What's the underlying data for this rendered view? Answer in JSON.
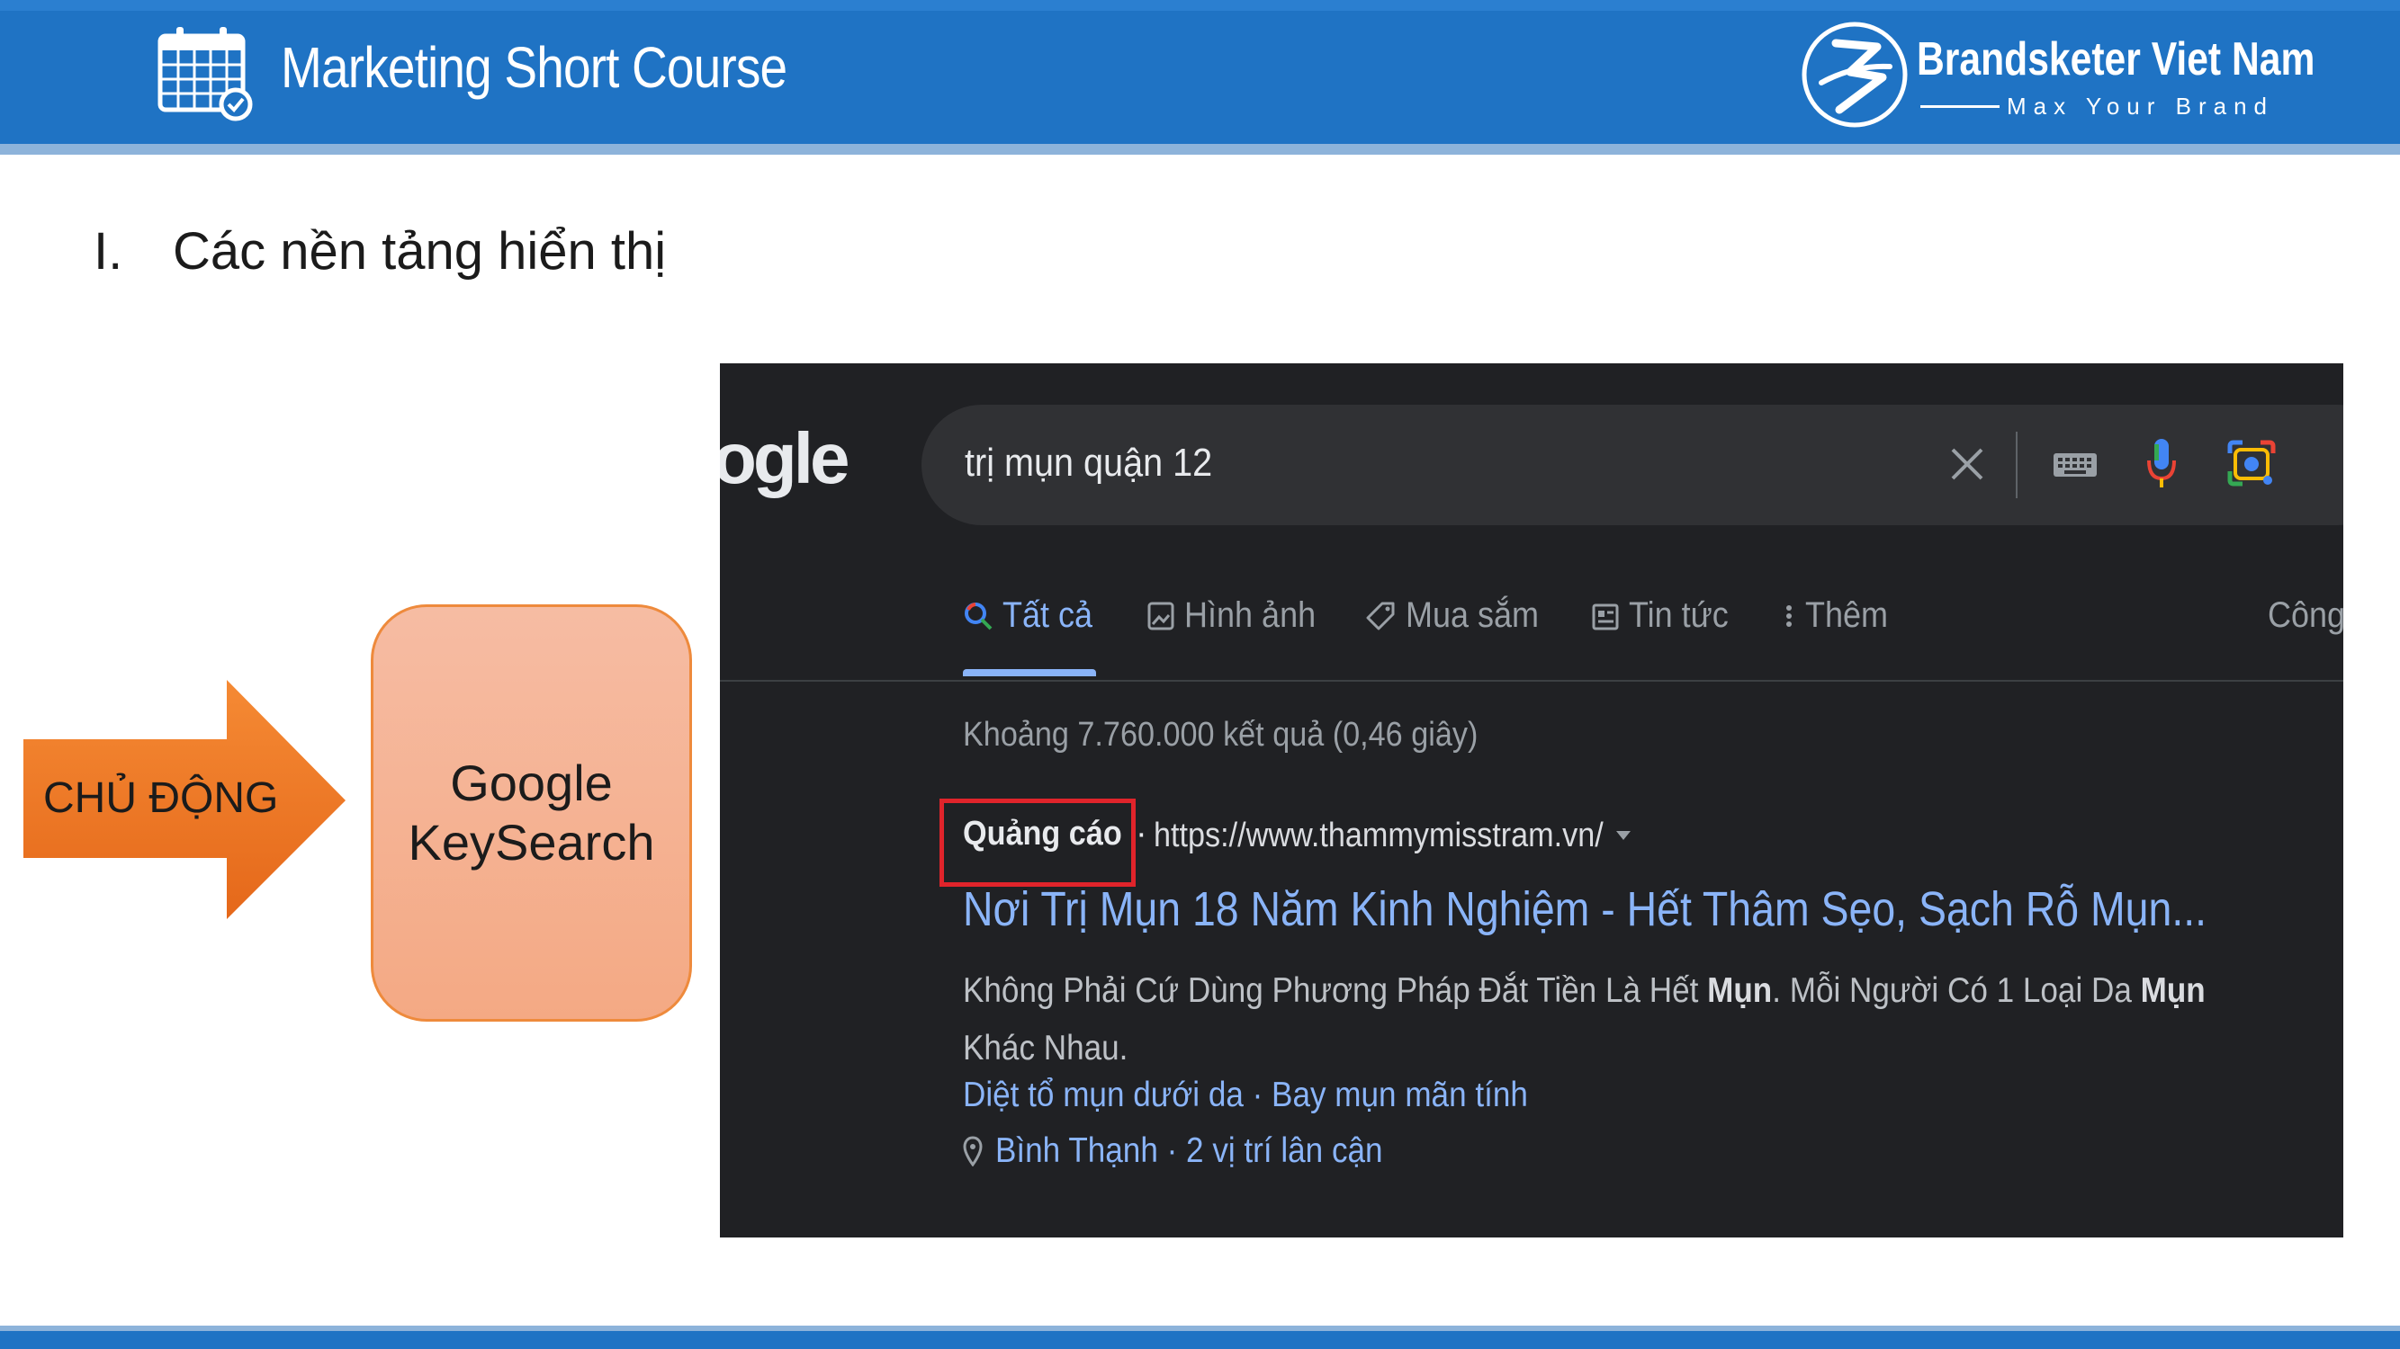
{
  "header": {
    "course_title": "Marketing Short Course",
    "brand_name": "Brandsketer Viet Nam",
    "brand_tagline": "Max Your Brand",
    "colors": {
      "band": "#1f73c4",
      "accent_line": "#8db3da"
    }
  },
  "section": {
    "number": "I.",
    "title": "Các nền tảng hiển thị"
  },
  "diagram": {
    "arrow_label": "CHỦ ĐỘNG",
    "box_line1": "Google",
    "box_line2": "KeySearch",
    "colors": {
      "arrow": "#f07a22",
      "box": "#f5b293",
      "box_border": "#ee8a3c"
    }
  },
  "google": {
    "logo_fragment": "ogle",
    "query": "trị mụn quận 12",
    "tabs": [
      {
        "label": "Tất cả",
        "icon": "search-icon",
        "active": true
      },
      {
        "label": "Hình ảnh",
        "icon": "image-icon"
      },
      {
        "label": "Mua sắm",
        "icon": "tag-icon"
      },
      {
        "label": "Tin tức",
        "icon": "news-icon"
      },
      {
        "label": "Thêm",
        "icon": "more-vert-icon"
      },
      {
        "label": "Công",
        "icon": ""
      }
    ],
    "stats": "Khoảng 7.760.000 kết quả (0,46 giây)",
    "ad": {
      "badge": "Quảng cáo",
      "url": "https://www.thammymisstram.vn/",
      "title": "Nơi Trị Mụn 18 Năm Kinh Nghiệm - Hết Thâm Sẹo, Sạch Rỗ Mụn...",
      "desc_1": "Không Phải Cứ Dùng Phương Pháp Đắt Tiền Là Hết ",
      "desc_bold_1": "Mụn",
      "desc_2": ". Mỗi Người Có 1 Loại Da ",
      "desc_bold_2": "Mụn",
      "desc_3": " Khác Nhau.",
      "sitelinks": "Diệt tổ mụn dưới da · Bay mụn mãn tính",
      "location": "Bình Thạnh · 2 vị trí lân cận"
    },
    "colors": {
      "background": "#202124",
      "link": "#8ab4f8",
      "highlight_box": "#e0242b"
    }
  }
}
